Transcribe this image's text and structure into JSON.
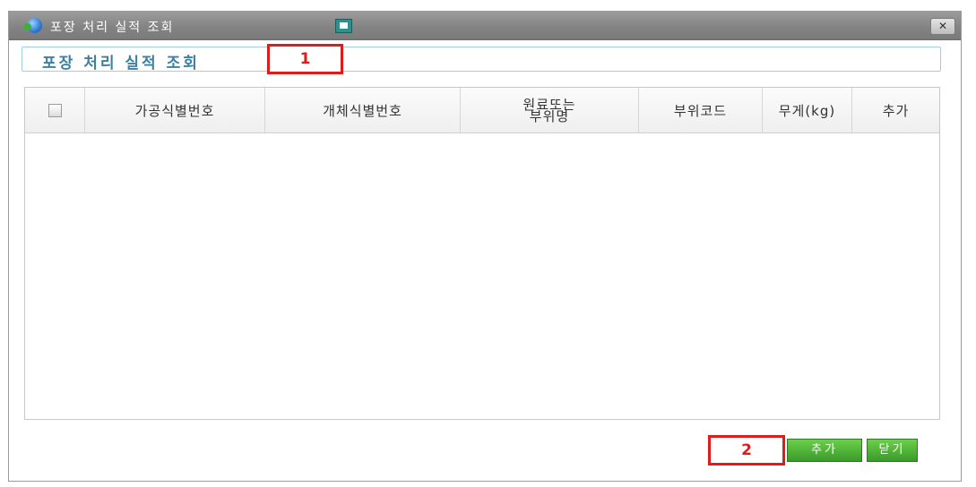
{
  "window": {
    "title": "포장 처리 실적 조회",
    "close_label": "✕"
  },
  "heading": "포장 처리 실적 조회",
  "markers": [
    "1",
    "2"
  ],
  "table": {
    "columns": [
      "가공식별번호",
      "개체식별번호",
      "원료또는\n부위명",
      "부위코드",
      "무게(kg)",
      "추가"
    ],
    "rows": []
  },
  "buttons": {
    "add_label": "추가",
    "close_label": "닫기"
  },
  "colors": {
    "accent": "#3d7fa0",
    "button_green": "#4cb034",
    "marker_red": "#e01b1b"
  }
}
